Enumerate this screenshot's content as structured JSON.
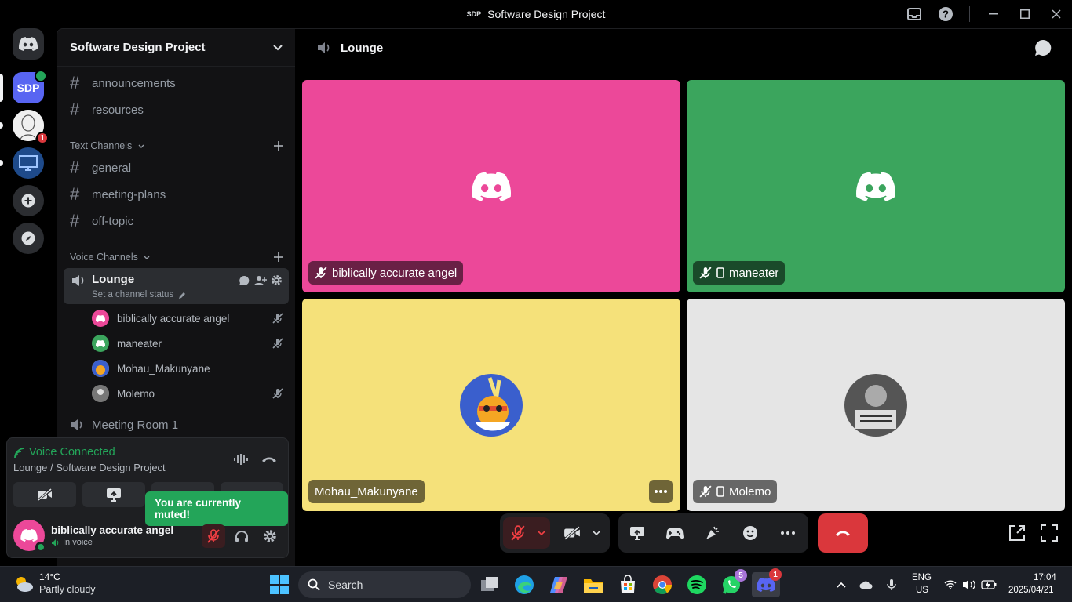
{
  "window": {
    "badge": "SDP",
    "title": "Software Design Project"
  },
  "sidebar": {
    "server_name": "Software Design Project",
    "channels_top": [
      "announcements",
      "resources"
    ],
    "text_category": "Text Channels",
    "text_channels": [
      "general",
      "meeting-plans",
      "off-topic"
    ],
    "voice_category": "Voice Channels",
    "lounge": {
      "name": "Lounge",
      "status_placeholder": "Set a channel status"
    },
    "members": [
      "biblically accurate angel",
      "maneater",
      "Mohau_Makunyane",
      "Molemo"
    ],
    "meeting_room": "Meeting Room 1"
  },
  "servers": {
    "sdp_label": "SDP",
    "unread_count": "1"
  },
  "voice": {
    "status": "Voice Connected",
    "location": "Lounge / Software Design Project",
    "tooltip": "You are currently muted!",
    "user_name": "biblically accurate angel",
    "user_status": "In voice"
  },
  "main": {
    "channel": "Lounge",
    "tiles": [
      {
        "name": "biblically accurate angel",
        "color": "#ec4899"
      },
      {
        "name": "maneater",
        "color": "#3ba55d"
      },
      {
        "name": "Mohau_Makunyane",
        "color": "#f5e17a"
      },
      {
        "name": "Molemo",
        "color": "#e5e5e5"
      }
    ]
  },
  "taskbar": {
    "temperature": "14°C",
    "weather": "Partly cloudy",
    "search_label": "Search",
    "whatsapp_badge": "5",
    "discord_badge": "1",
    "lang1": "ENG",
    "lang2": "US",
    "time": "17:04",
    "date": "2025/04/21"
  },
  "colors": {
    "accent_green": "#23a559",
    "danger_red": "#da373c",
    "blurple": "#5865f2"
  }
}
